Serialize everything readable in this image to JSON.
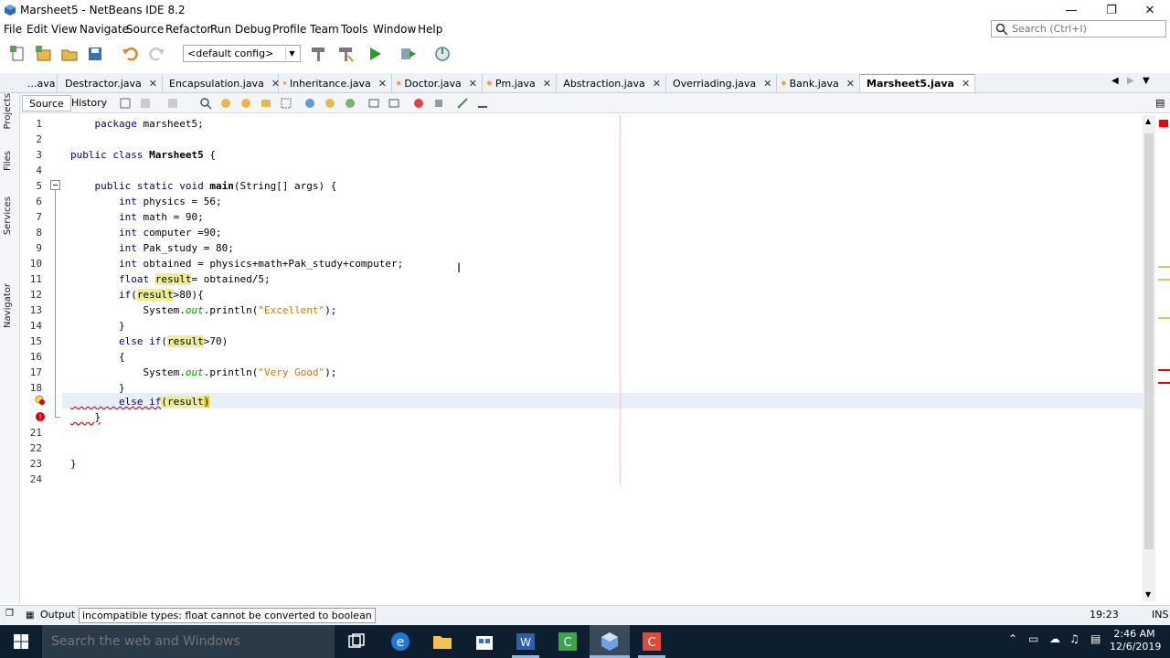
{
  "window": {
    "title": "Marsheet5 - NetBeans IDE 8.2",
    "app_icon": "netbeans-cube-icon",
    "controls": [
      "minimize",
      "maximize",
      "close"
    ]
  },
  "menu": [
    "File",
    "Edit",
    "View",
    "Navigate",
    "Source",
    "Refactor",
    "Run",
    "Debug",
    "Profile",
    "Team",
    "Tools",
    "Window",
    "Help"
  ],
  "search": {
    "placeholder": "Search (Ctrl+I)"
  },
  "toolbar": {
    "config": "<default config>"
  },
  "tabs": [
    {
      "label": "...ava",
      "closable": true
    },
    {
      "label": "Destractor.java",
      "closable": true
    },
    {
      "label": "Encapsulation.java",
      "closable": true
    },
    {
      "label": "Inheritance.java",
      "closable": true
    },
    {
      "label": "Doctor.java",
      "closable": true
    },
    {
      "label": "Pm.java",
      "closable": true
    },
    {
      "label": "Abstraction.java",
      "closable": true
    },
    {
      "label": "Overriading.java",
      "closable": true
    },
    {
      "label": "Bank.java",
      "closable": true
    },
    {
      "label": "Marsheet5.java",
      "closable": true,
      "active": true
    }
  ],
  "side_panels": [
    "Projects",
    "Files",
    "Services",
    "Navigator"
  ],
  "editor_tabs": {
    "source": "Source",
    "history": "History"
  },
  "code": {
    "lines": [
      "    package marsheet5;",
      "",
      "public class Marsheet5 {",
      "",
      "    public static void main(String[] args) {",
      "        int physics = 56;",
      "        int math = 90;",
      "        int computer =90;",
      "        int Pak_study = 80;",
      "        int obtained = physics+math+Pak_study+computer;",
      "        float result= obtained/5;",
      "        if(result>80){",
      "            System.out.println(\"Excellent\");",
      "        }",
      "        else if(result>70)",
      "        {",
      "            System.out.println(\"Very Good\");",
      "        }",
      "        else if(result)",
      "    }",
      "",
      "",
      "}",
      ""
    ],
    "line_numbers": [
      "1",
      "2",
      "3",
      "4",
      "5",
      "6",
      "7",
      "8",
      "9",
      "10",
      "11",
      "12",
      "13",
      "14",
      "15",
      "16",
      "17",
      "18",
      "",
      "",
      "21",
      "22",
      "23",
      "24"
    ],
    "error_lines": [
      19,
      20
    ]
  },
  "status": {
    "output_tab": "Output",
    "message": "incompatible types: float cannot be converted to boolean",
    "position": "19:23",
    "mode": "INS"
  },
  "taskbar": {
    "search_placeholder": "Search the web and Windows",
    "time": "2:46 AM",
    "date": "12/6/2019"
  }
}
